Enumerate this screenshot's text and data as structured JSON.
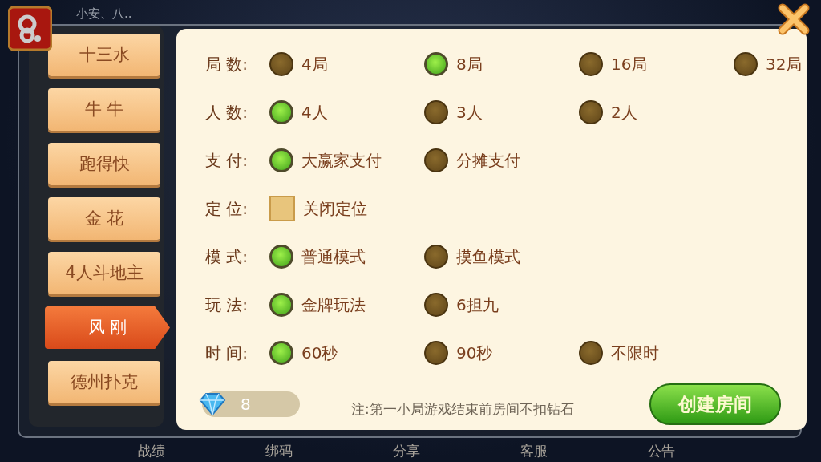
{
  "top_label": "小安、八..",
  "game_tabs": [
    {
      "label": "十三水",
      "selected": false
    },
    {
      "label": "牛 牛",
      "selected": false
    },
    {
      "label": "跑得快",
      "selected": false
    },
    {
      "label": "金 花",
      "selected": false
    },
    {
      "label": "4人斗地主",
      "selected": false
    },
    {
      "label": "风 刚",
      "selected": true
    },
    {
      "label": "德州扑克",
      "selected": false
    }
  ],
  "settings": [
    {
      "label": "局 数:",
      "options": [
        {
          "kind": "radio",
          "label": "4局",
          "selected": false
        },
        {
          "kind": "radio",
          "label": "8局",
          "selected": true
        },
        {
          "kind": "radio",
          "label": "16局",
          "selected": false
        },
        {
          "kind": "radio",
          "label": "32局",
          "selected": false
        }
      ]
    },
    {
      "label": "人 数:",
      "options": [
        {
          "kind": "radio",
          "label": "4人",
          "selected": true
        },
        {
          "kind": "radio",
          "label": "3人",
          "selected": false
        },
        {
          "kind": "radio",
          "label": "2人",
          "selected": false
        }
      ]
    },
    {
      "label": "支 付:",
      "options": [
        {
          "kind": "radio",
          "label": "大赢家支付",
          "selected": true
        },
        {
          "kind": "radio",
          "label": "分摊支付",
          "selected": false
        }
      ]
    },
    {
      "label": "定 位:",
      "options": [
        {
          "kind": "checkbox",
          "label": "关闭定位",
          "checked": false
        }
      ]
    },
    {
      "label": "模 式:",
      "options": [
        {
          "kind": "radio",
          "label": "普通模式",
          "selected": true
        },
        {
          "kind": "radio",
          "label": "摸鱼模式",
          "selected": false
        }
      ]
    },
    {
      "label": "玩 法:",
      "options": [
        {
          "kind": "radio",
          "label": "金牌玩法",
          "selected": true
        },
        {
          "kind": "radio",
          "label": "6担九",
          "selected": false
        }
      ]
    },
    {
      "label": "时 间:",
      "options": [
        {
          "kind": "radio",
          "label": "60秒",
          "selected": true
        },
        {
          "kind": "radio",
          "label": "90秒",
          "selected": false
        },
        {
          "kind": "radio",
          "label": "不限时",
          "selected": false
        }
      ]
    }
  ],
  "diamonds": {
    "count": "8"
  },
  "note": "注:第一小局游戏结束前房间不扣钻石",
  "create_button": "创建房间",
  "bottom_bar": [
    {
      "label": "战绩"
    },
    {
      "label": "绑码"
    },
    {
      "label": "分享"
    },
    {
      "label": "客服"
    },
    {
      "label": "公告"
    }
  ]
}
